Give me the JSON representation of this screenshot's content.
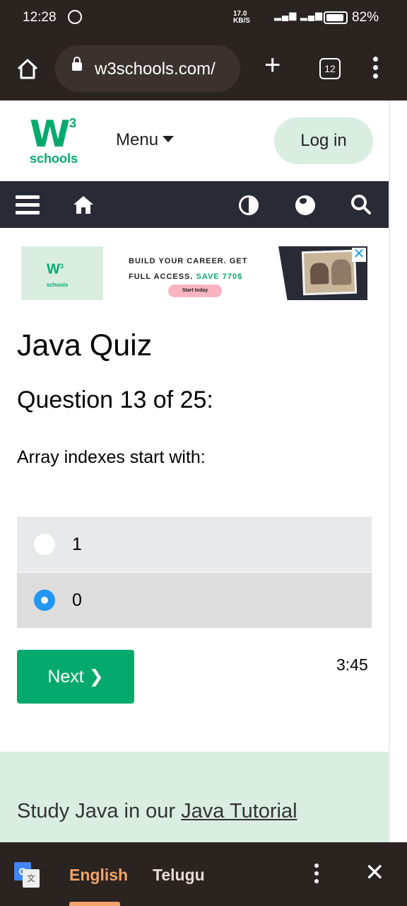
{
  "status_bar": {
    "time": "12:28",
    "net_speed_line1": "17.0",
    "net_speed_line2": "KB/S",
    "battery": "82%"
  },
  "browser": {
    "url": "w3schools.com/",
    "tab_count": "12"
  },
  "site_header": {
    "logo_superscript": "3",
    "logo_text": "schools",
    "menu_label": "Menu",
    "login_label": "Log in"
  },
  "ad": {
    "line1": "BUILD YOUR CAREER. GET",
    "line2": "FULL ACCESS.",
    "save_text": "SAVE 770$",
    "button": "Start today",
    "logo_sup": "3",
    "logo_text": "schools"
  },
  "quiz": {
    "title": "Java Quiz",
    "question_number": "Question 13 of 25:",
    "question_text": "Array indexes start with:",
    "options": [
      {
        "label": "1",
        "checked": false
      },
      {
        "label": "0",
        "checked": true
      }
    ],
    "next_label": "Next ❯",
    "timer": "3:45"
  },
  "study": {
    "prefix": "Study Java in our ",
    "link_text": "Java Tutorial"
  },
  "translate_bar": {
    "lang_selected": "English",
    "lang_other": "Telugu"
  },
  "colors": {
    "brand_green": "#04aa6d",
    "mint": "#d9eee1",
    "navbar": "#282a35",
    "radio_checked": "#2196f3",
    "translate_accent": "#f0a36b"
  }
}
